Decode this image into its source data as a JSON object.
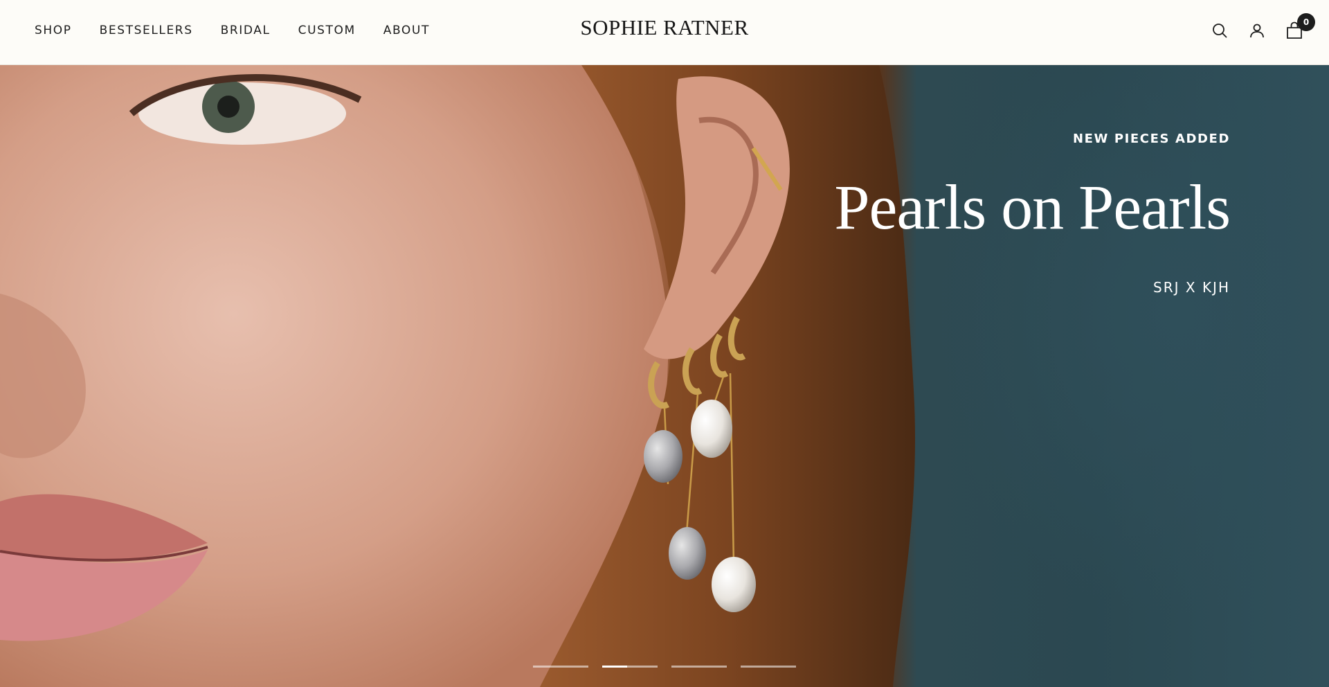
{
  "header": {
    "nav": [
      "SHOP",
      "BESTSELLERS",
      "BRIDAL",
      "CUSTOM",
      "ABOUT"
    ],
    "logo": "SOPHIE RATNER",
    "icons": [
      "search-icon",
      "account-icon",
      "cart-icon"
    ],
    "cart_count": "0"
  },
  "hero": {
    "eyebrow": "NEW PIECES ADDED",
    "headline": "Pearls on Pearls",
    "subline": "SRJ X KJH",
    "slides_total": 4,
    "active_slide": 2,
    "active_slide_progress": 0.45
  },
  "colors": {
    "header_bg": "#fdfcf8",
    "text": "#1c1c1c",
    "hero_text": "#ffffff",
    "teal_bg": "#2b4851"
  }
}
